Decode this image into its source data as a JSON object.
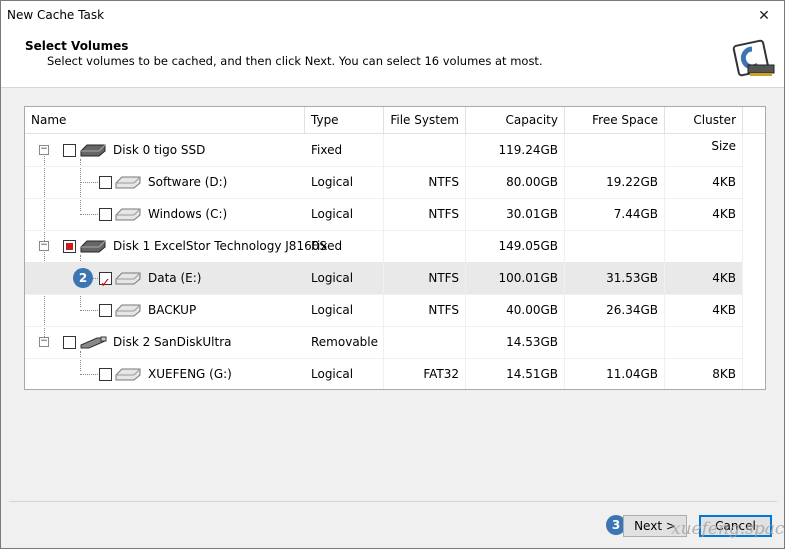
{
  "window": {
    "title": "New Cache Task"
  },
  "header": {
    "title": "Select Volumes",
    "subtitle": "Select volumes to be cached, and then click Next. You can select 16 volumes at most."
  },
  "columns": [
    "Name",
    "Type",
    "File System",
    "Capacity",
    "Free Space",
    "Cluster Size"
  ],
  "rows": [
    {
      "name": "Disk 0 tigo SSD",
      "type": "Fixed",
      "fs": "",
      "capacity": "119.24GB",
      "free": "",
      "cluster": ""
    },
    {
      "name": "Software (D:)",
      "type": "Logical",
      "fs": "NTFS",
      "capacity": "80.00GB",
      "free": "19.22GB",
      "cluster": "4KB"
    },
    {
      "name": "Windows (C:)",
      "type": "Logical",
      "fs": "NTFS",
      "capacity": "30.01GB",
      "free": "7.44GB",
      "cluster": "4KB"
    },
    {
      "name": "Disk 1 ExcelStor Technology J8160S",
      "type": "Fixed",
      "fs": "",
      "capacity": "149.05GB",
      "free": "",
      "cluster": ""
    },
    {
      "name": "Data (E:)",
      "type": "Logical",
      "fs": "NTFS",
      "capacity": "100.01GB",
      "free": "31.53GB",
      "cluster": "4KB"
    },
    {
      "name": "BACKUP",
      "type": "Logical",
      "fs": "NTFS",
      "capacity": "40.00GB",
      "free": "26.34GB",
      "cluster": "4KB"
    },
    {
      "name": "Disk 2 SanDiskUltra",
      "type": "Removable",
      "fs": "",
      "capacity": "14.53GB",
      "free": "",
      "cluster": ""
    },
    {
      "name": "XUEFENG (G:)",
      "type": "Logical",
      "fs": "FAT32",
      "capacity": "14.51GB",
      "free": "11.04GB",
      "cluster": "8KB"
    }
  ],
  "badges": {
    "step2": "2",
    "step3": "3"
  },
  "buttons": {
    "next_label": "Next >",
    "cancel_label": "Cancel"
  },
  "watermark": "xuefeng.space",
  "colors": {
    "accent": "#3c75b4",
    "check": "#d00000",
    "focus": "#0078d7"
  }
}
